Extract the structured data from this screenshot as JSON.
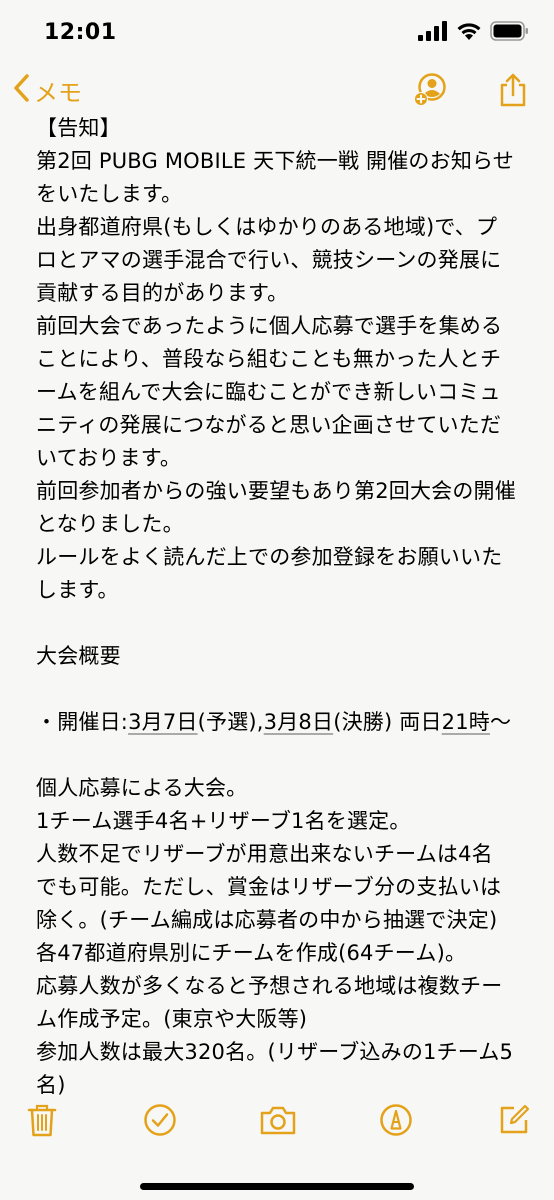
{
  "status_bar": {
    "time": "12:01"
  },
  "nav": {
    "back_label": "メモ"
  },
  "note": {
    "lines": [
      {
        "text": "【告知】"
      },
      {
        "text": "第2回 PUBG MOBILE 天下統一戦 開催のお知らせ"
      },
      {
        "text": "をいたします。"
      },
      {
        "text": "出身都道府県(もしくはゆかりのある地域)で、プ"
      },
      {
        "text": "ロとアマの選手混合で行い、競技シーンの発展に"
      },
      {
        "text": "貢献する目的があります。"
      },
      {
        "text": "前回大会であったように個人応募で選手を集める"
      },
      {
        "text": "ことにより、普段なら組むことも無かった人とチ"
      },
      {
        "text": "ームを組んで大会に臨むことができ新しいコミュ"
      },
      {
        "text": "ニティの発展につながると思い企画させていただ"
      },
      {
        "text": "いております。"
      },
      {
        "text": "前回参加者からの強い要望もあり第2回大会の開催"
      },
      {
        "text": "となりました。"
      },
      {
        "text": "ルールをよく読んだ上での参加登録をお願いいた"
      },
      {
        "text": "します。"
      },
      {
        "text": ""
      },
      {
        "text": "大会概要"
      },
      {
        "text": ""
      },
      {
        "text": ""
      },
      {
        "text": ""
      },
      {
        "text": "個人応募による大会。"
      },
      {
        "text": "1チーム選手4名+リザーブ1名を選定。"
      },
      {
        "text": "人数不足でリザーブが用意出来ないチームは4名"
      },
      {
        "text": "でも可能。ただし、賞金はリザーブ分の支払いは"
      },
      {
        "text": "除く。(チーム編成は応募者の中から抽選で決定)"
      },
      {
        "text": "各47都道府県別にチームを作成(64チーム)。"
      },
      {
        "text": "応募人数が多くなると予想される地域は複数チー"
      },
      {
        "text": "ム作成予定。(東京や大阪等)"
      },
      {
        "text": "参加人数は最大320名。(リザーブ込みの1チーム5"
      },
      {
        "text": "名)"
      }
    ],
    "schedule": {
      "prefix": "・開催日:",
      "date1": "3月7日",
      "mid1": "(予選),",
      "date2": "3月8日",
      "mid2": "(決勝) 両日",
      "time": "21時",
      "suffix": "〜"
    }
  },
  "colors": {
    "accent": "#e3a21a",
    "background": "#f7f7f5",
    "text": "#000000"
  },
  "icons": {
    "back": "chevron-left-icon",
    "add_people": "add-person-icon",
    "share": "share-icon",
    "delete": "trash-icon",
    "checklist": "checkmark-circle-icon",
    "camera": "camera-icon",
    "markup": "pen-circle-icon",
    "compose": "compose-icon"
  }
}
